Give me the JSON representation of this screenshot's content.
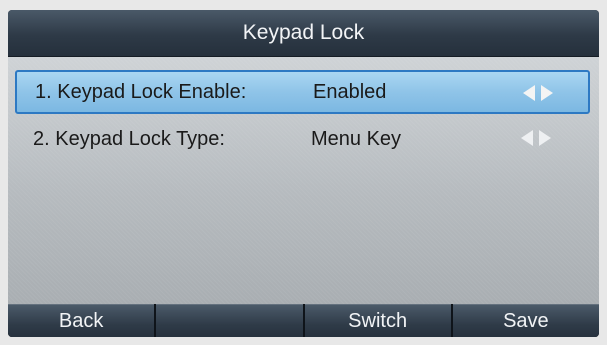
{
  "title": "Keypad Lock",
  "rows": [
    {
      "label": "1. Keypad Lock Enable:",
      "value": "Enabled",
      "selected": true
    },
    {
      "label": "2. Keypad Lock Type:",
      "value": "Menu Key",
      "selected": false
    }
  ],
  "softkeys": [
    "Back",
    "",
    "Switch",
    "Save"
  ],
  "icons": {
    "prev": "left-arrow-icon",
    "next": "right-arrow-icon"
  },
  "colors": {
    "selection": "#8fc4e8",
    "selection_border": "#2d79c3"
  }
}
